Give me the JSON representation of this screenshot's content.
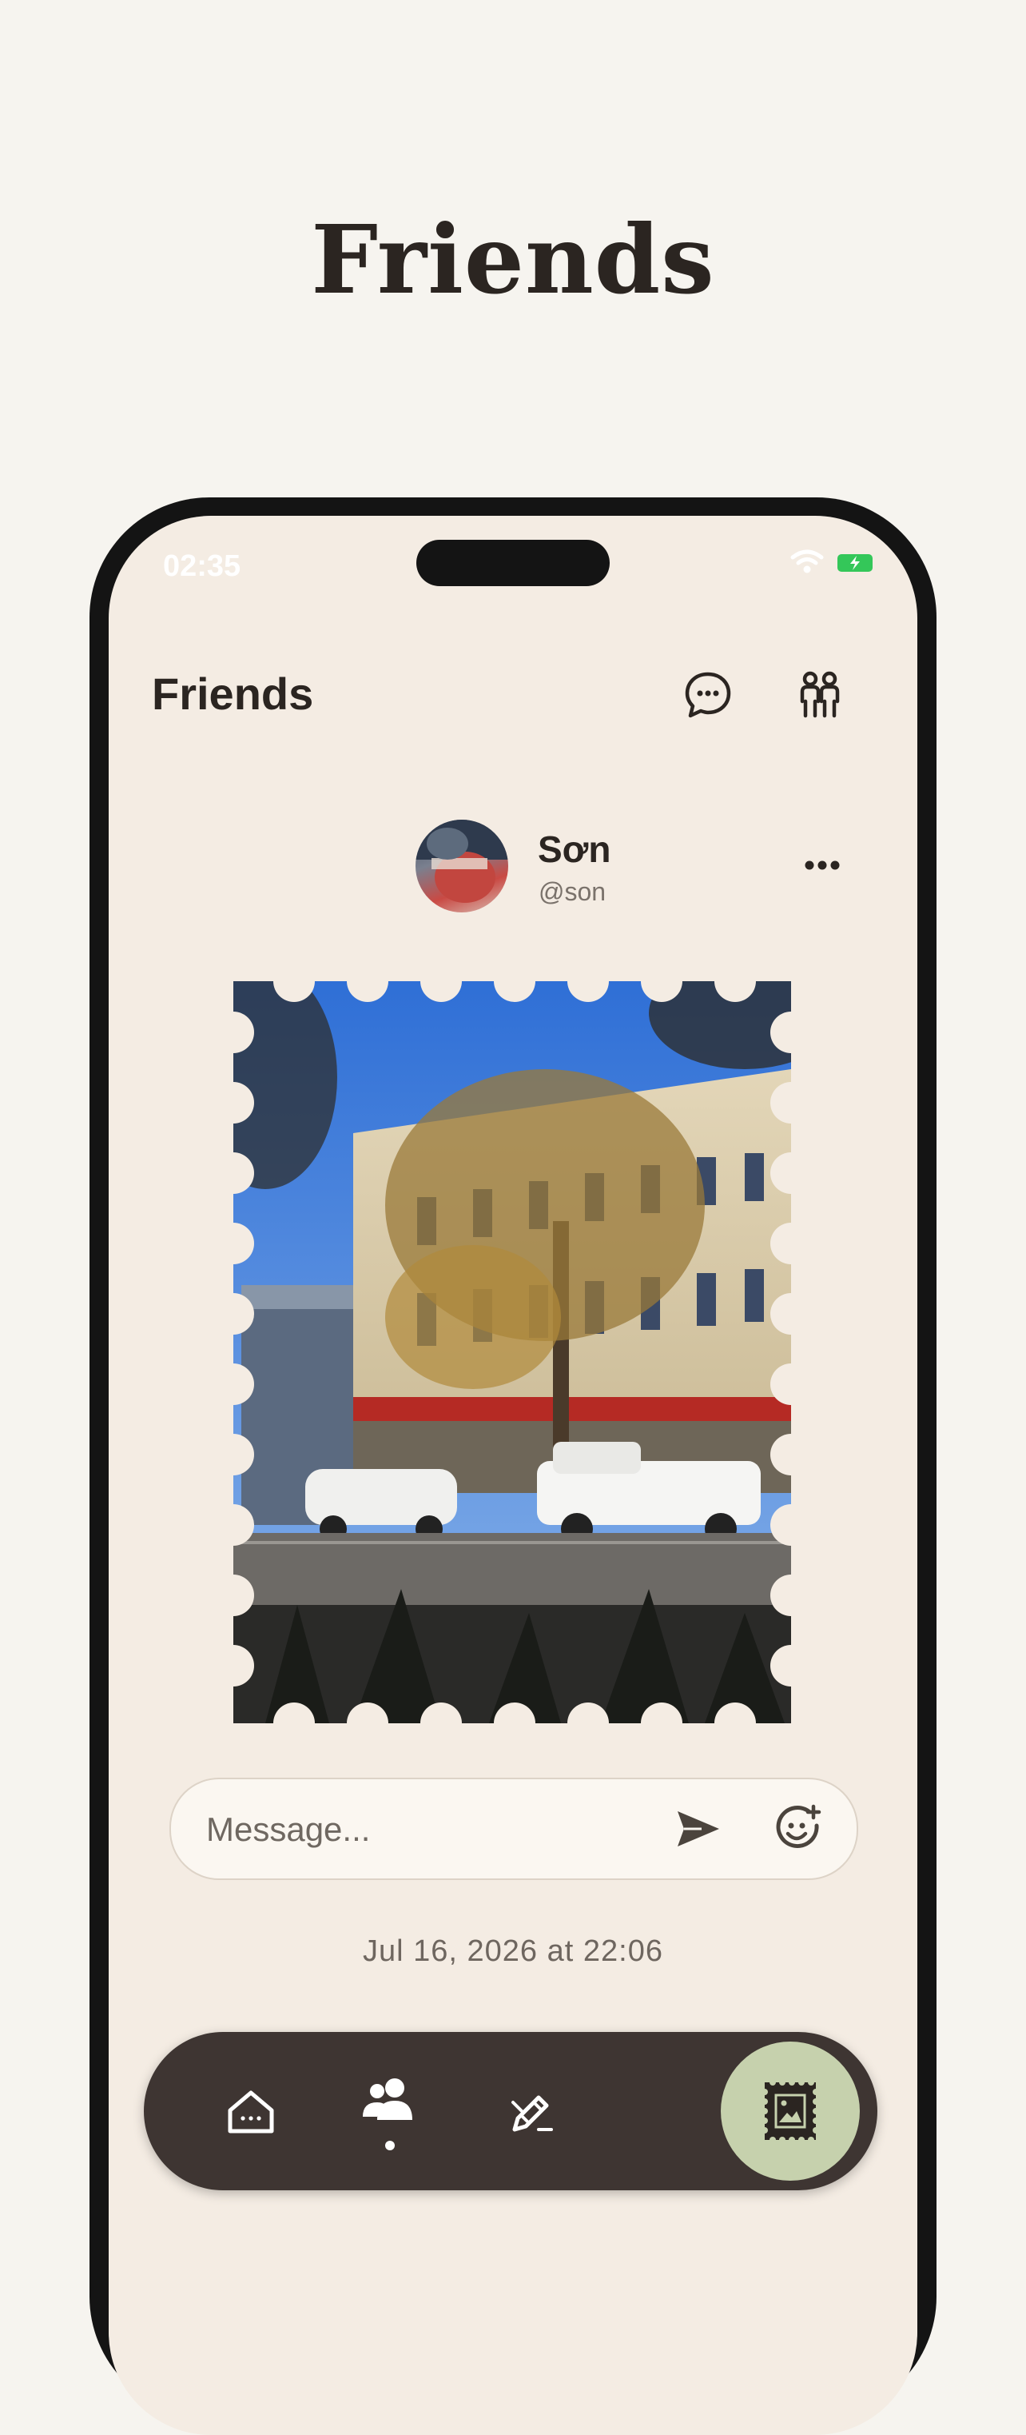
{
  "page": {
    "title": "Friends"
  },
  "status_bar": {
    "time": "02:35",
    "wifi_icon": "wifi-icon",
    "battery_icon": "battery-charging-icon",
    "battery_color": "#34c759"
  },
  "header": {
    "title": "Friends",
    "chat_icon": "chat-bubble-icon",
    "friends_icon": "people-icon"
  },
  "post": {
    "user_name": "Sơn",
    "user_handle": "@son",
    "more_icon": "ellipsis-icon",
    "photo_description_icon": "stamp-photo"
  },
  "message": {
    "placeholder": "Message...",
    "send_icon": "send-icon",
    "emoji_icon": "add-emoji-icon"
  },
  "timestamp": "Jul 16, 2026 at 22:06",
  "tabbar": {
    "items": [
      {
        "icon": "home-icon",
        "active": false
      },
      {
        "icon": "people-icon",
        "active": true
      },
      {
        "icon": "pencil-icon",
        "active": false
      },
      {
        "icon": "stamp-icon",
        "active": false
      }
    ],
    "accent": "#c6d1ad",
    "background": "#3e3532"
  }
}
